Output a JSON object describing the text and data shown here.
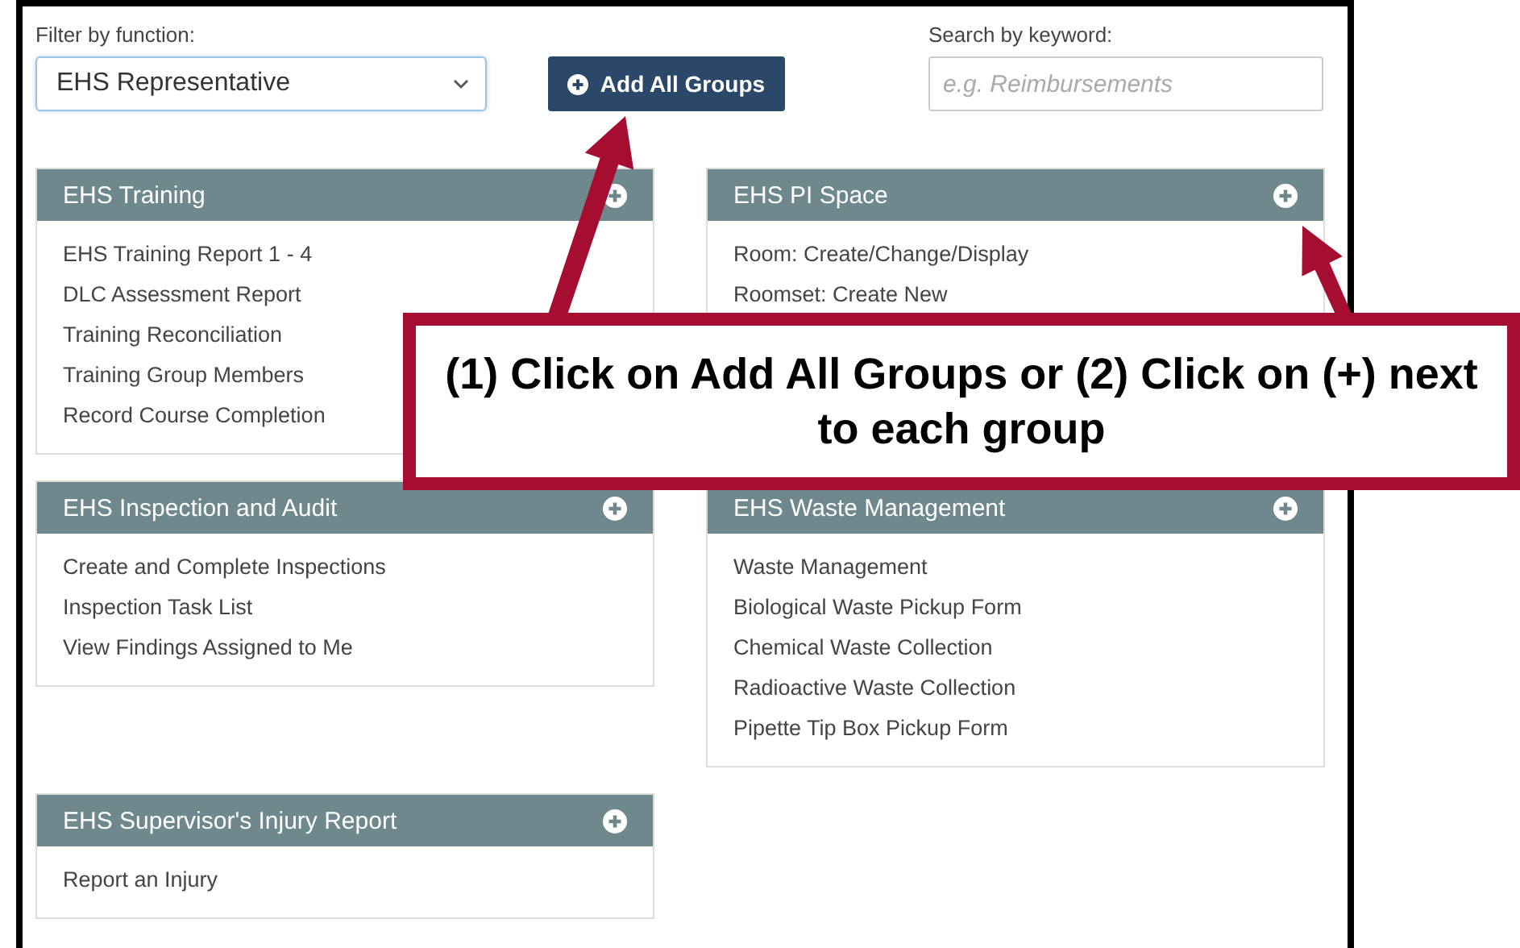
{
  "filter": {
    "label": "Filter by function:",
    "value": "EHS Representative"
  },
  "add_all_button": {
    "label": "Add All Groups"
  },
  "search": {
    "label": "Search by keyword:",
    "placeholder": "e.g. Reimbursements"
  },
  "left_column": [
    {
      "title": "EHS Training",
      "items": [
        "EHS Training Report 1 - 4",
        "DLC Assessment Report",
        "Training Reconciliation",
        "Training Group Members",
        "Record Course Completion"
      ]
    },
    {
      "title": "EHS Inspection and Audit",
      "items": [
        "Create and Complete Inspections",
        "Inspection Task List",
        "View Findings Assigned to Me"
      ]
    },
    {
      "title": "EHS Supervisor's Injury Report",
      "items": [
        "Report an Injury"
      ]
    }
  ],
  "right_column": [
    {
      "title": "EHS PI Space",
      "items": [
        "Room: Create/Change/Display",
        "Roomset: Create New"
      ]
    },
    {
      "title": "EHS Waste Management",
      "items": [
        "Waste Management",
        "Biological Waste Pickup Form",
        "Chemical Waste Collection",
        "Radioactive Waste Collection",
        "Pipette Tip Box Pickup Form"
      ]
    }
  ],
  "callout": {
    "text": "(1) Click on Add All Groups or (2) Click on (+) next to each group"
  }
}
